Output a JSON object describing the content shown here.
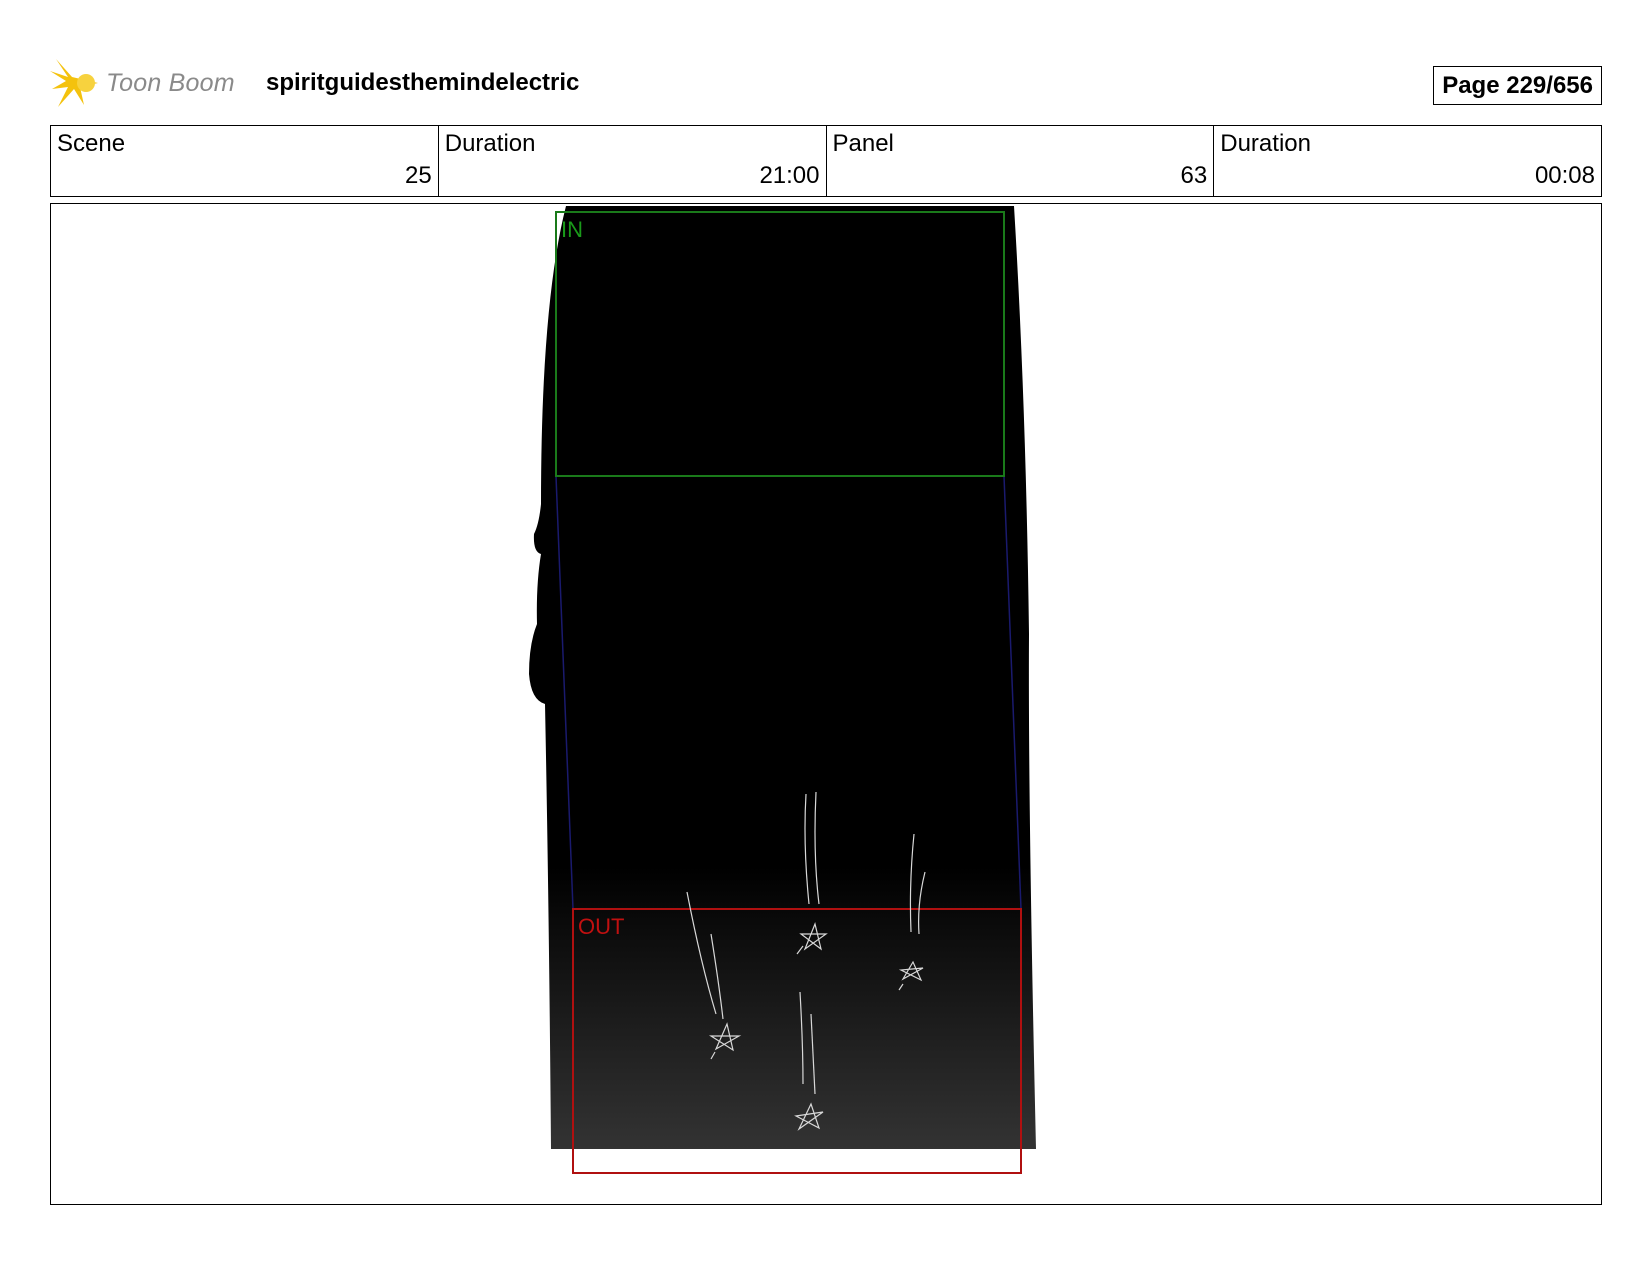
{
  "header": {
    "logo_text": "Toon Boom",
    "project_title": "spiritguidesthemindelectric",
    "page_label": "Page 229/656"
  },
  "info": {
    "scene": {
      "label": "Scene",
      "value": "25"
    },
    "scene_duration": {
      "label": "Duration",
      "value": "21:00"
    },
    "panel": {
      "label": "Panel",
      "value": "63"
    },
    "panel_duration": {
      "label": "Duration",
      "value": "00:08"
    }
  },
  "panel": {
    "in_label": "IN",
    "out_label": "OUT",
    "colors": {
      "in_frame": "#1a7a1a",
      "out_frame": "#b01010",
      "camera_path": "#1a1a6e",
      "background": "#000000"
    }
  }
}
